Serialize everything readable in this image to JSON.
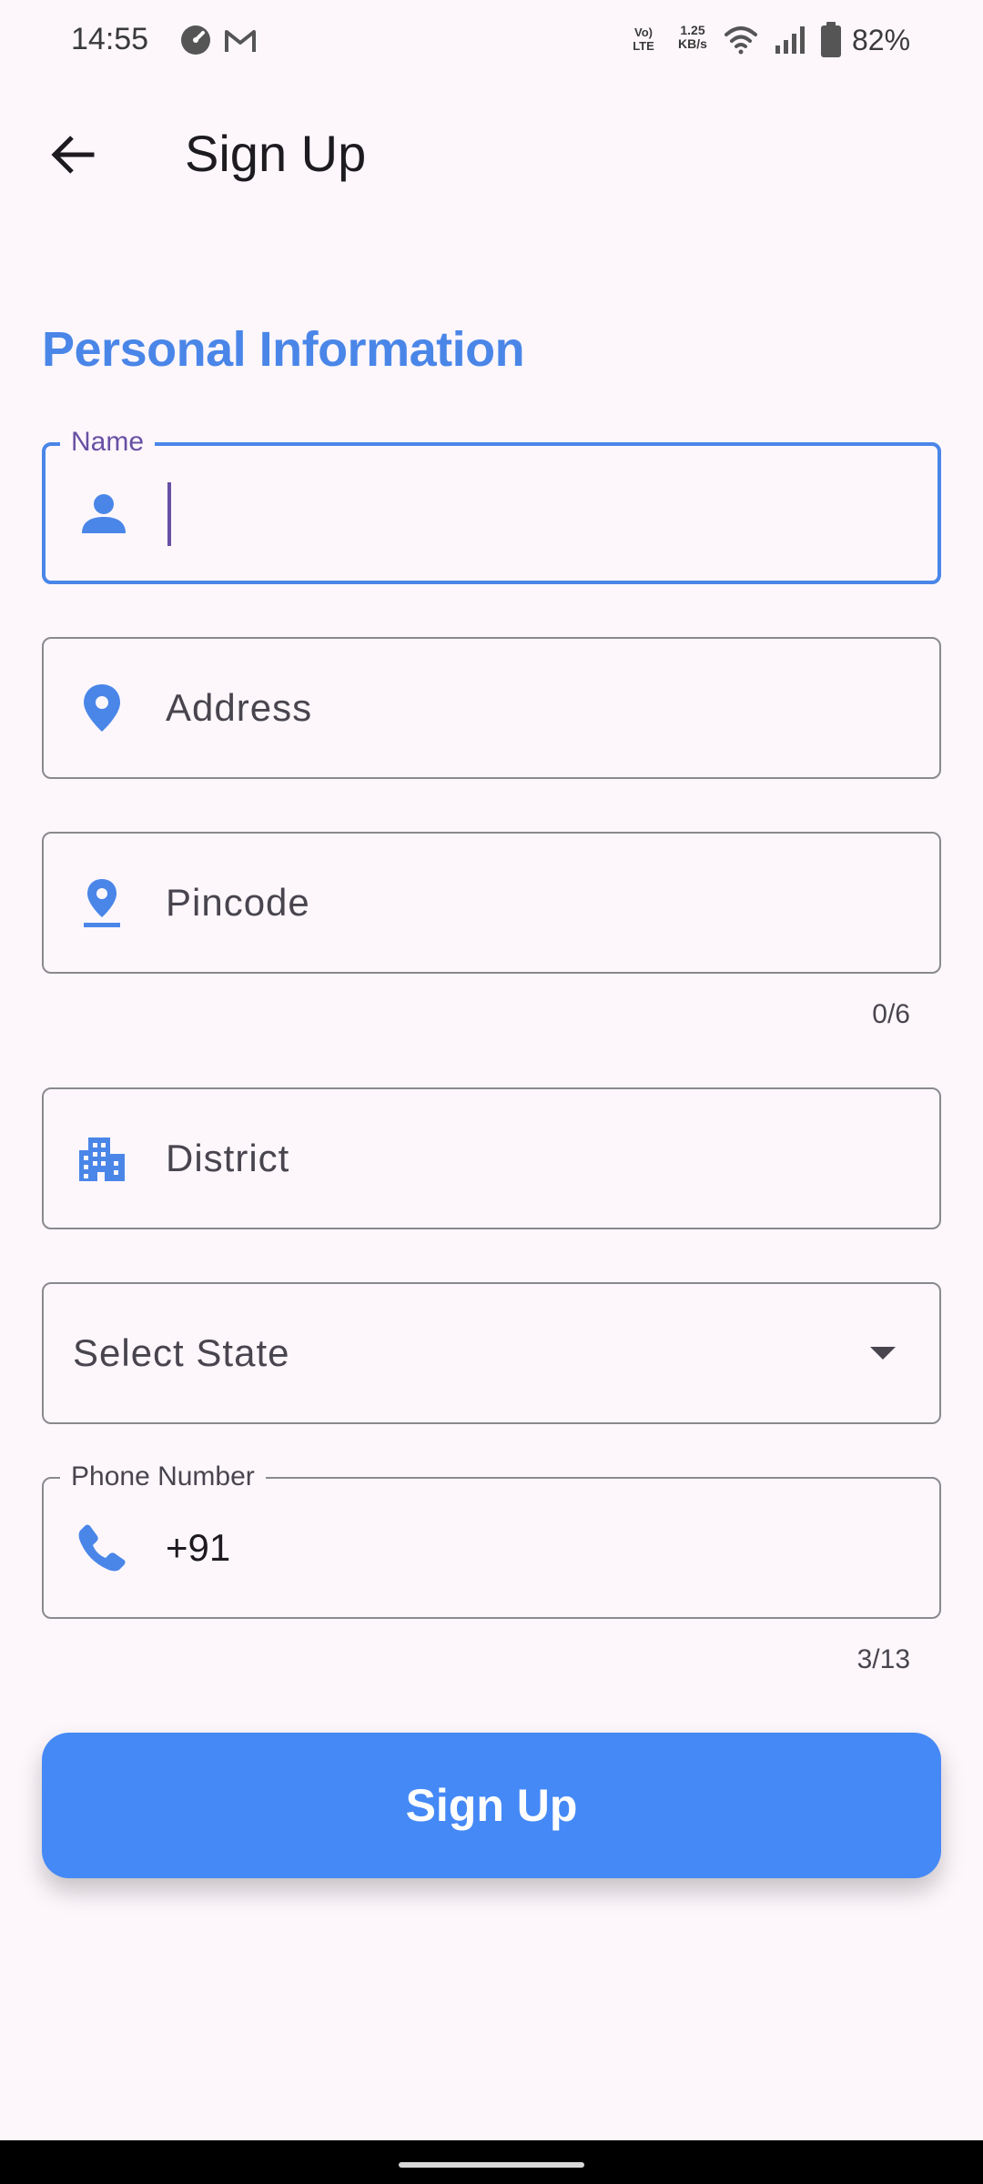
{
  "status_bar": {
    "time": "14:55",
    "volte_label": "Vo) LTE",
    "net_speed_value": "1.25",
    "net_speed_unit": "KB/s",
    "battery_percent": "82%",
    "icons": [
      "speedometer-icon",
      "gmail-icon",
      "volte-icon",
      "wifi-icon",
      "signal-icon",
      "battery-icon"
    ]
  },
  "app_bar": {
    "back_icon": "arrow-back-icon",
    "title": "Sign Up"
  },
  "section": {
    "title": "Personal Information"
  },
  "form": {
    "name": {
      "label": "Name",
      "value": "",
      "icon": "person-icon",
      "focused": true
    },
    "address": {
      "placeholder": "Address",
      "icon": "location-pin-icon"
    },
    "pincode": {
      "placeholder": "Pincode",
      "icon": "pin-drop-icon",
      "counter": "0/6"
    },
    "district": {
      "placeholder": "District",
      "icon": "apartment-icon"
    },
    "state": {
      "placeholder": "Select State",
      "icon": "arrow-drop-down-icon"
    },
    "phone": {
      "label": "Phone Number",
      "value": "+91",
      "icon": "phone-icon",
      "counter": "3/13"
    }
  },
  "actions": {
    "signup_label": "Sign Up"
  },
  "colors": {
    "accent": "#4a86e8",
    "button": "#4589f6",
    "focus_label": "#6750a4",
    "background": "#fdf7fc"
  }
}
